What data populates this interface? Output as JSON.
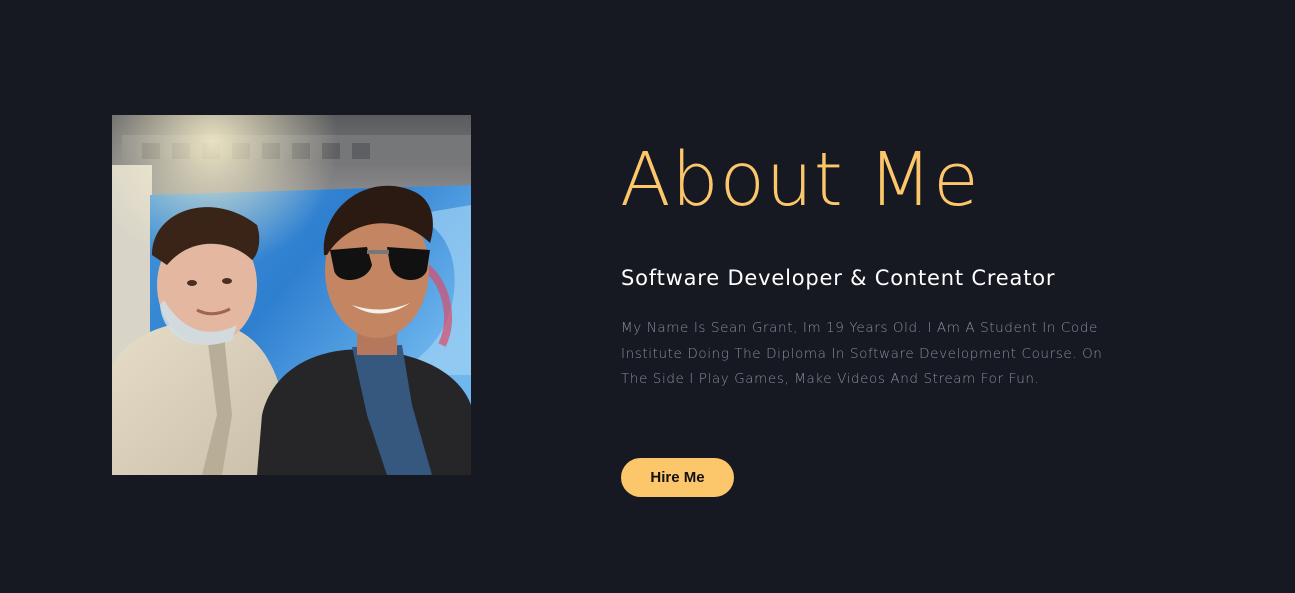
{
  "about": {
    "title": "About Me",
    "subtitle": "Software Developer & Content Creator",
    "bio": "My Name Is Sean Grant, Im 19 Years Old. I Am A Student In Code Institute Doing The Diploma In Software Development Course. On The Side I Play Games, Make Videos And Stream For Fun.",
    "hire_button_label": "Hire Me"
  },
  "colors": {
    "background": "#171922",
    "accent": "#fcc66b",
    "heading_white": "#ffffff",
    "body_text": "#8a8d98"
  }
}
